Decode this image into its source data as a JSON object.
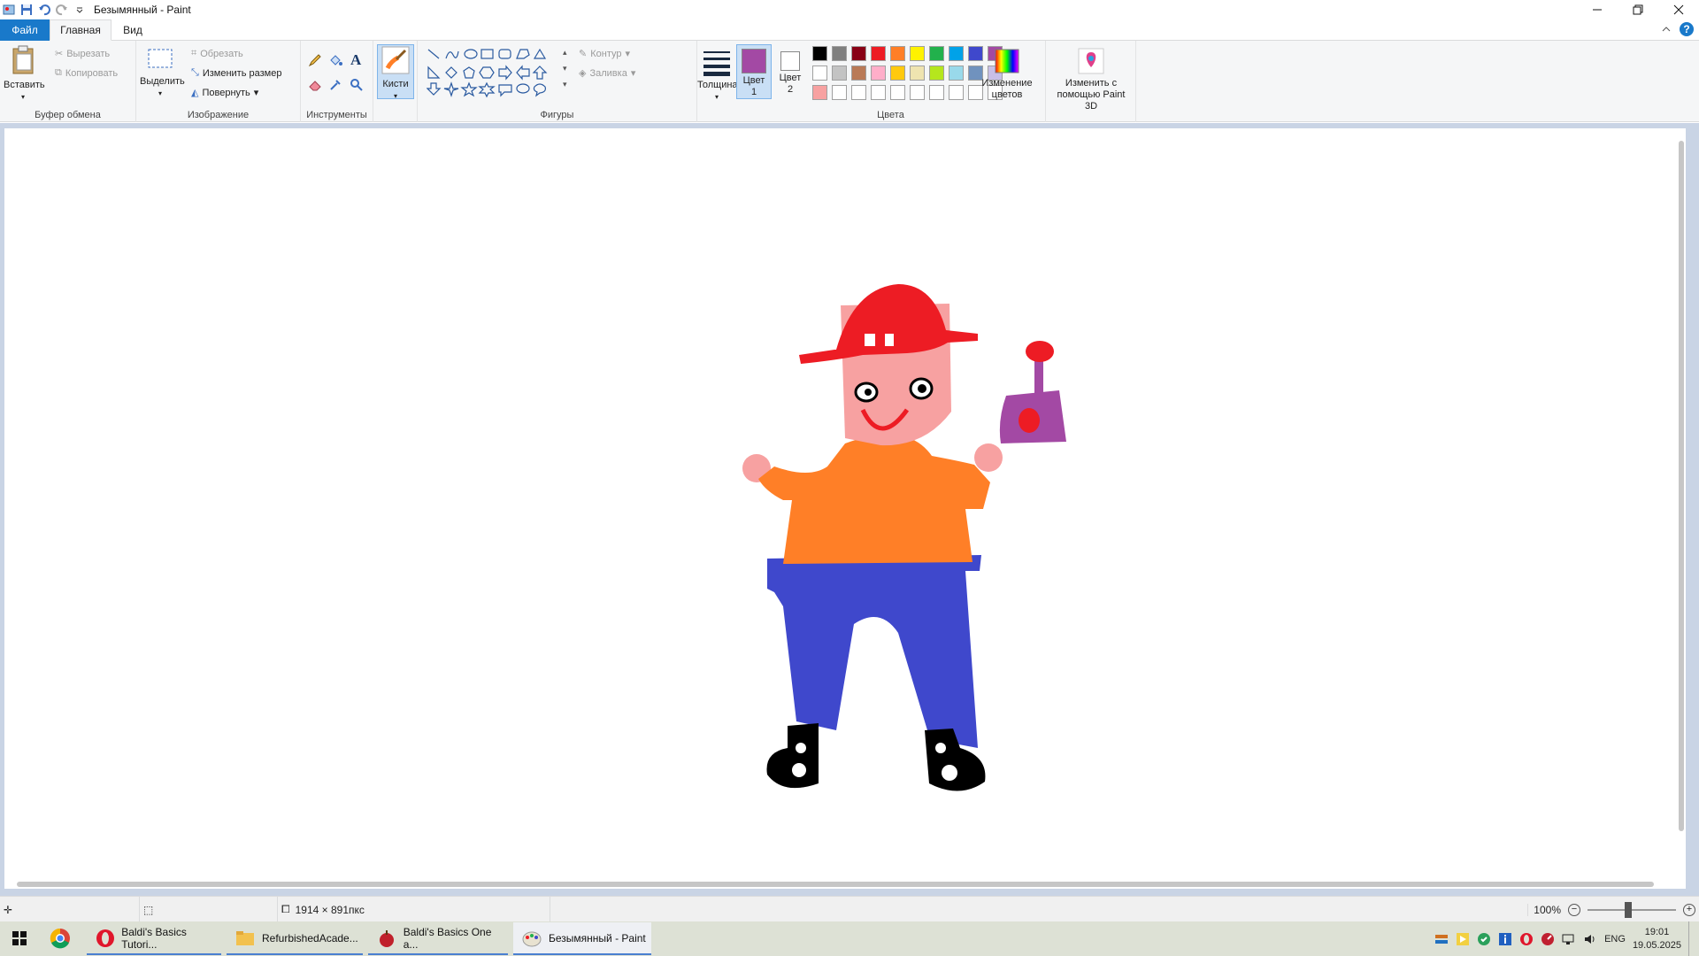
{
  "window": {
    "title": "Безымянный - Paint"
  },
  "tabs": {
    "file": "Файл",
    "home": "Главная",
    "view": "Вид"
  },
  "clipboard": {
    "paste": "Вставить",
    "cut": "Вырезать",
    "copy": "Копировать",
    "group": "Буфер обмена"
  },
  "image": {
    "select": "Выделить",
    "crop": "Обрезать",
    "resize": "Изменить размер",
    "rotate": "Повернуть",
    "group": "Изображение"
  },
  "tools": {
    "group": "Инструменты",
    "brushes": "Кисти"
  },
  "shapes": {
    "outline": "Контур",
    "fill": "Заливка",
    "group": "Фигуры"
  },
  "size": {
    "label": "Толщина"
  },
  "colors": {
    "color1": "Цвет 1",
    "color2": "Цвет 2",
    "color1_value": "#a349a4",
    "color2_value": "#ffffff",
    "edit": "Изменение цветов",
    "group": "Цвета",
    "palette_row1": [
      "#000000",
      "#7f7f7f",
      "#880015",
      "#ed1c24",
      "#ff7f27",
      "#fff200",
      "#22b14c",
      "#00a2e8",
      "#3f48cc",
      "#a349a4"
    ],
    "palette_row2": [
      "#ffffff",
      "#c3c3c3",
      "#b97a57",
      "#ffaec9",
      "#ffc90e",
      "#efe4b0",
      "#b5e61d",
      "#99d9ea",
      "#7092be",
      "#c8bfe7"
    ],
    "palette_row3": [
      "#f7a1a1",
      "#ffffff",
      "#ffffff",
      "#ffffff",
      "#ffffff",
      "#ffffff",
      "#ffffff",
      "#ffffff",
      "#ffffff",
      "#ffffff"
    ]
  },
  "paint3d": {
    "label": "Изменить с помощью Paint 3D"
  },
  "status": {
    "dimensions": "1914 × 891пкс",
    "zoom": "100%"
  },
  "taskbar": {
    "tasks": [
      {
        "label": "Baldi's Basics Tutori...",
        "icon": "opera-icon"
      },
      {
        "label": "RefurbishedAcade...",
        "icon": "folder-icon"
      },
      {
        "label": "Baldi's Basics One a...",
        "icon": "apple-icon"
      },
      {
        "label": "Безымянный - Paint",
        "icon": "paint-icon"
      }
    ],
    "lang": "ENG",
    "time": "19:01",
    "date": "19.05.2025"
  },
  "drawing": {
    "colors": {
      "hat": "#ed1c24",
      "face": "#f7a1a1",
      "shirt": "#ff7f27",
      "pants": "#3f48cc",
      "shoes": "#000000",
      "device": "#a349a4"
    }
  }
}
